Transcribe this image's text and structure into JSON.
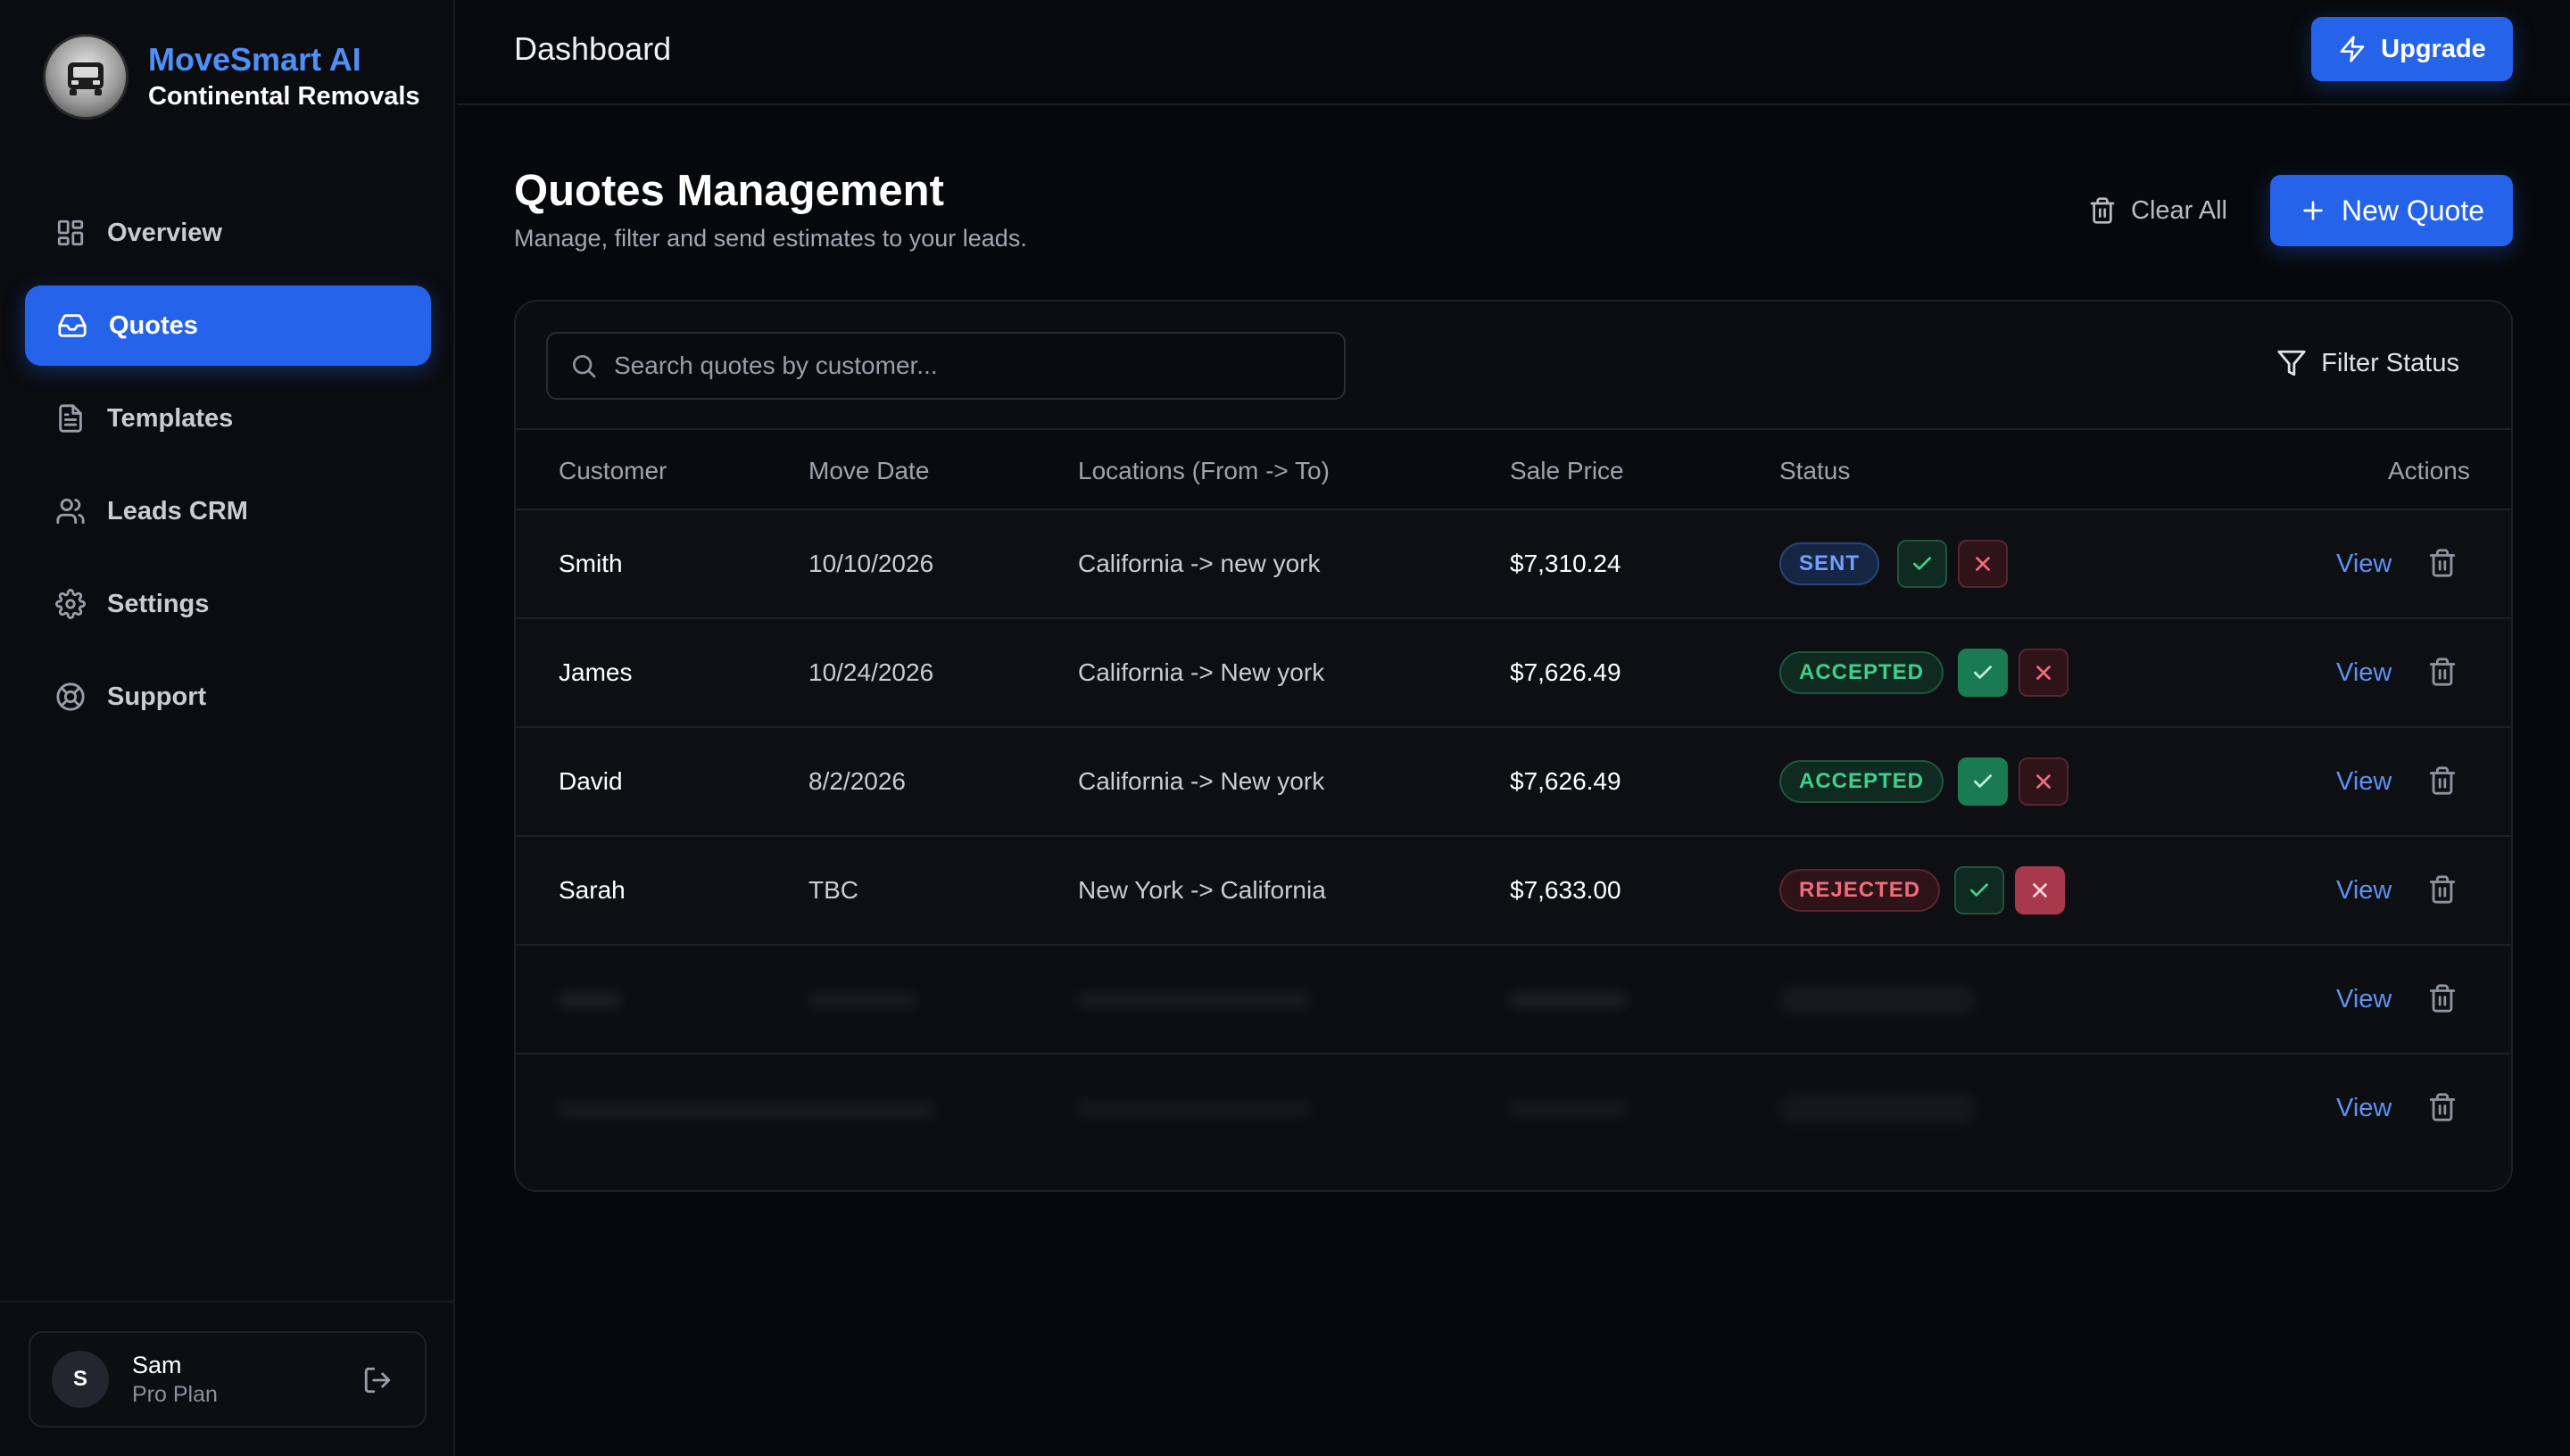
{
  "brand": {
    "name": "MoveSmart AI",
    "company": "Continental Removals"
  },
  "sidebar": {
    "items": [
      {
        "label": "Overview",
        "icon": "grid-icon",
        "active": false
      },
      {
        "label": "Quotes",
        "icon": "inbox-icon",
        "active": true
      },
      {
        "label": "Templates",
        "icon": "file-icon",
        "active": false
      },
      {
        "label": "Leads CRM",
        "icon": "users-icon",
        "active": false
      },
      {
        "label": "Settings",
        "icon": "gear-icon",
        "active": false
      },
      {
        "label": "Support",
        "icon": "lifebuoy-icon",
        "active": false
      }
    ]
  },
  "user": {
    "initial": "S",
    "name": "Sam",
    "plan": "Pro Plan"
  },
  "topbar": {
    "title": "Dashboard",
    "upgrade_label": "Upgrade"
  },
  "main": {
    "title": "Quotes Management",
    "subtitle": "Manage, filter and send estimates to your leads.",
    "clear_all_label": "Clear All",
    "new_quote_label": "New Quote",
    "search_placeholder": "Search quotes by customer...",
    "filter_label": "Filter Status"
  },
  "table": {
    "headers": [
      "Customer",
      "Move Date",
      "Locations (From -> To)",
      "Sale Price",
      "Status",
      "Actions"
    ],
    "rows": [
      {
        "customer": "Smith",
        "date": "10/10/2026",
        "locations": "California -> new york",
        "price": "$7,310.24",
        "status": "SENT"
      },
      {
        "customer": "James",
        "date": "10/24/2026",
        "locations": "California -> New york",
        "price": "$7,626.49",
        "status": "ACCEPTED"
      },
      {
        "customer": "David",
        "date": "8/2/2026",
        "locations": "California -> New york",
        "price": "$7,626.49",
        "status": "ACCEPTED"
      },
      {
        "customer": "Sarah",
        "date": "TBC",
        "locations": "New York -> California",
        "price": "$7,633.00",
        "status": "REJECTED"
      }
    ],
    "view_label": "View"
  },
  "colors": {
    "accent": "#2563eb",
    "link": "#5b93f5",
    "accepted": "#3fd08e",
    "rejected": "#f26b7c",
    "sent": "#70a0ff"
  }
}
